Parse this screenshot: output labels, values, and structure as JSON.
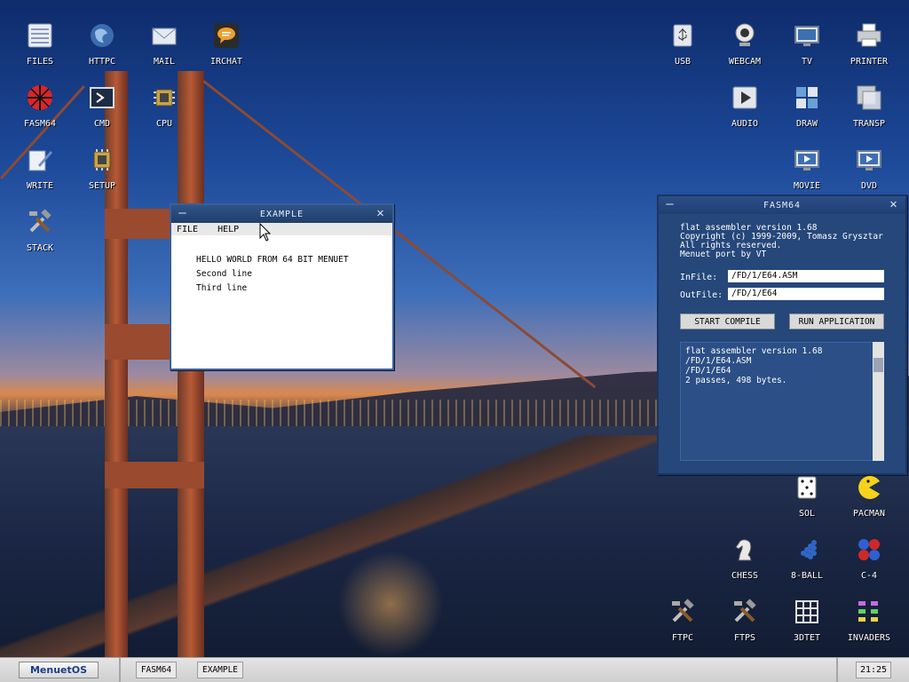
{
  "desktop": {
    "icons_left": [
      {
        "label": "FILES",
        "icon": "files-icon"
      },
      {
        "label": "HTTPC",
        "icon": "globe-icon"
      },
      {
        "label": "MAIL",
        "icon": "mail-icon"
      },
      {
        "label": "IRCHAT",
        "icon": "chat-icon"
      },
      {
        "label": "FASM64",
        "icon": "fasm-icon"
      },
      {
        "label": "CMD",
        "icon": "terminal-icon"
      },
      {
        "label": "CPU",
        "icon": "cpu-icon"
      },
      {
        "label": "WRITE",
        "icon": "write-icon"
      },
      {
        "label": "SETUP",
        "icon": "setup-icon"
      },
      {
        "label": "STACK",
        "icon": "tools-icon"
      }
    ],
    "icons_right": [
      {
        "label": "USB",
        "icon": "usb-icon"
      },
      {
        "label": "WEBCAM",
        "icon": "webcam-icon"
      },
      {
        "label": "TV",
        "icon": "tv-icon"
      },
      {
        "label": "PRINTER",
        "icon": "printer-icon"
      },
      {
        "label": "AUDIO",
        "icon": "audio-icon"
      },
      {
        "label": "DRAW",
        "icon": "draw-icon"
      },
      {
        "label": "TRANSP",
        "icon": "transparency-icon"
      },
      {
        "label": "MOVIE",
        "icon": "movie-icon"
      },
      {
        "label": "DVD",
        "icon": "dvd-icon"
      },
      {
        "label": "SOL",
        "icon": "dice-icon"
      },
      {
        "label": "PACMAN",
        "icon": "pacman-icon"
      },
      {
        "label": "CHESS",
        "icon": "chess-knight-icon"
      },
      {
        "label": "8-BALL",
        "icon": "8ball-icon"
      },
      {
        "label": "C-4",
        "icon": "connect4-icon"
      },
      {
        "label": "FTPC",
        "icon": "tools-icon"
      },
      {
        "label": "FTPS",
        "icon": "tools-icon"
      },
      {
        "label": "3DTET",
        "icon": "grid-icon"
      },
      {
        "label": "INVADERS",
        "icon": "invaders-icon"
      }
    ]
  },
  "example_window": {
    "title": "EXAMPLE",
    "menu": {
      "file": "FILE",
      "help": "HELP"
    },
    "lines": [
      "HELLO WORLD FROM 64 BIT MENUET",
      "Second line",
      "Third line"
    ]
  },
  "fasm_window": {
    "title": "FASM64",
    "header": [
      "flat assembler  version 1.68",
      "Copyright (c) 1999-2009, Tomasz Grysztar",
      "All rights reserved.",
      "Menuet port by VT"
    ],
    "infile_label": "InFile:",
    "infile_value": "/FD/1/E64.ASM",
    "outfile_label": "OutFile:",
    "outfile_value": "/FD/1/E64",
    "start_compile": "START COMPILE",
    "run_application": "RUN APPLICATION",
    "output": [
      "flat assembler  version 1.68",
      "/FD/1/E64.ASM",
      "/FD/1/E64",
      "2 passes, 498 bytes."
    ]
  },
  "taskbar": {
    "start_label": "MenuetOS",
    "tasks": [
      "FASM64",
      "EXAMPLE"
    ],
    "clock": "21:25"
  }
}
